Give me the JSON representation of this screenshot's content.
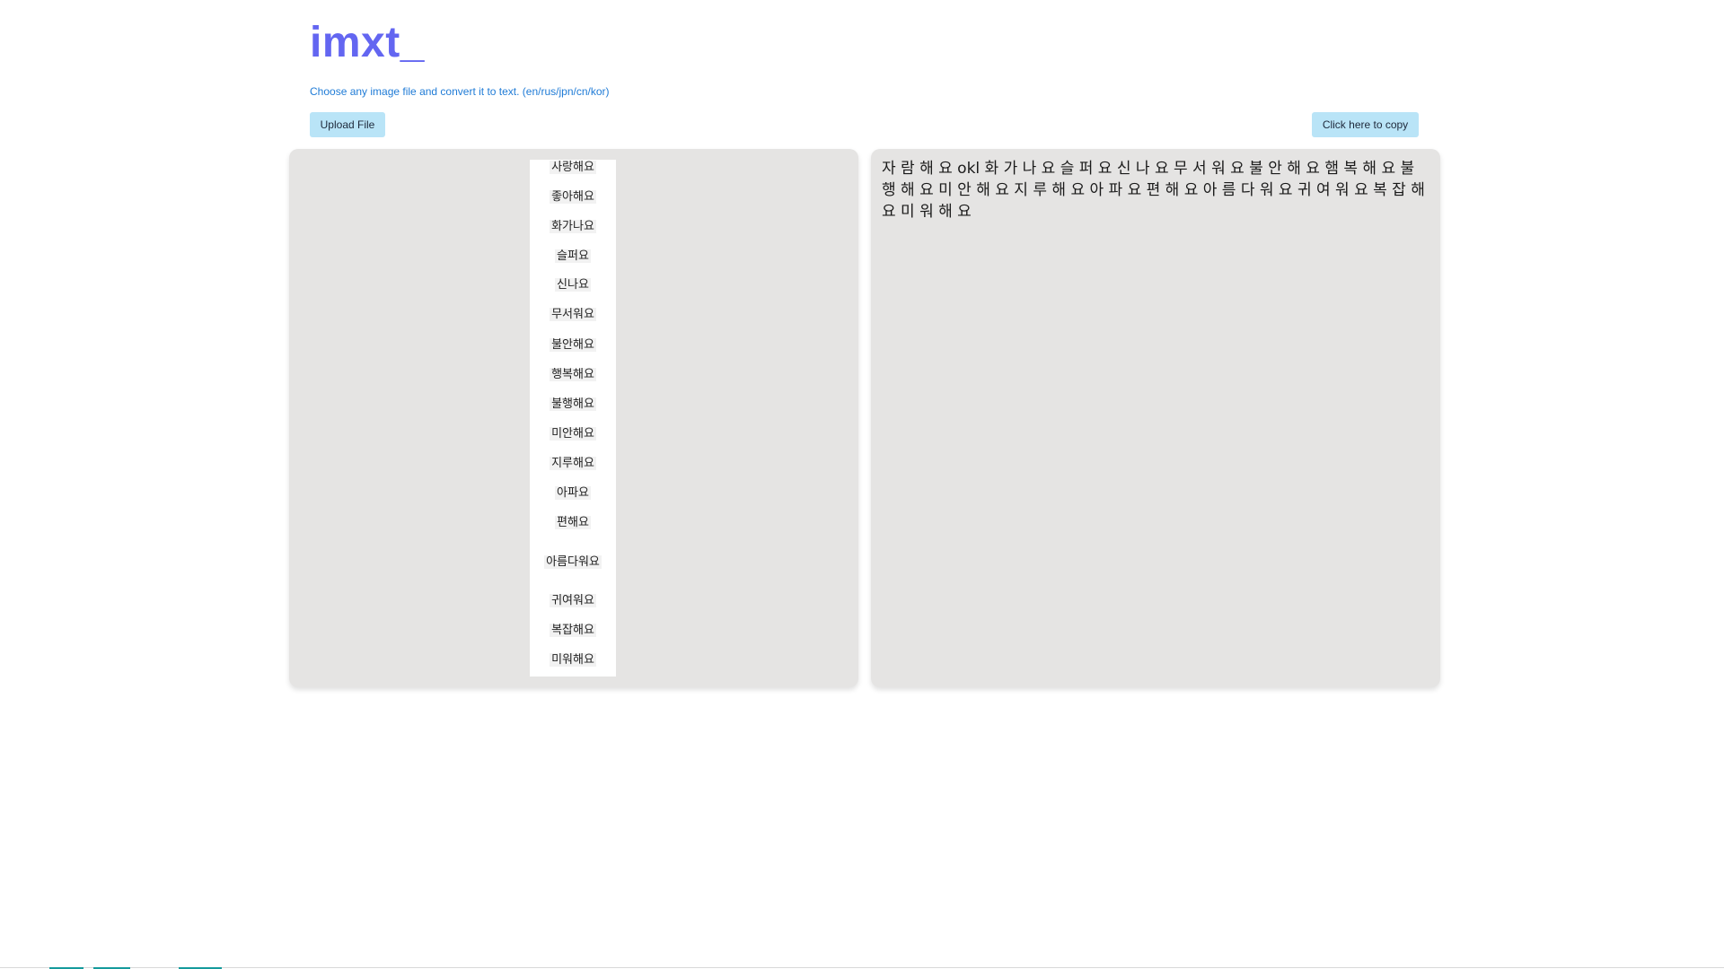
{
  "header": {
    "logo": "imxt_",
    "subtitle": "Choose any image file and convert it to text. (en/rus/jpn/cn/kor)"
  },
  "toolbar": {
    "upload_label": "Upload File",
    "copy_label": "Click here to copy"
  },
  "preview": {
    "words": [
      "사랑해요",
      "좋아해요",
      "화가나요",
      "슬퍼요",
      "신나요",
      "무서워요",
      "불안해요",
      "행복해요",
      "불행해요",
      "미안해요",
      "지루해요",
      "아파요",
      "편해요",
      "아름다워요",
      "귀여워요",
      "복잡해요",
      "미워해요"
    ]
  },
  "output": {
    "text": "자 람 해 요 okl 화 가 나 요 슬 퍼 요 신 나 요 무 서 워 요 불 안 해 요 햄 복 해 요 불 행 해 요 미 안 해 요 지 루 해 요 아 파 요 편 해 요 아 름 다 워 요 귀 여 워 요 복 잡 해 요 미 워 해 요"
  },
  "colors": {
    "logo": "#6366f1",
    "subtitle": "#1f7bd6",
    "button_bg": "#b9e4f7",
    "panel_bg": "#e5e4e3"
  }
}
